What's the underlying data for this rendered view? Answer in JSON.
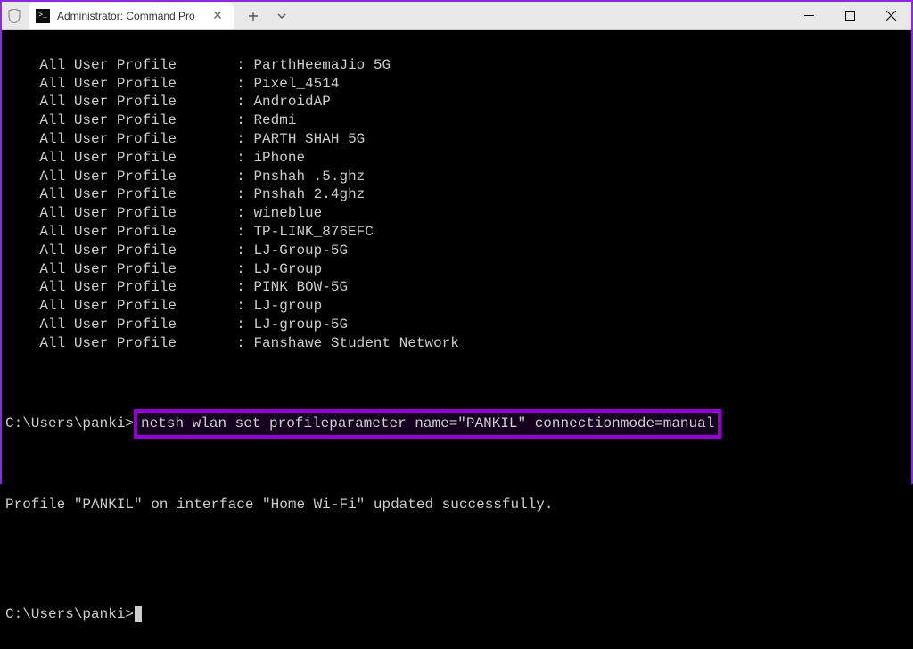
{
  "window": {
    "tab_title": "Administrator: Command Pro"
  },
  "profiles": {
    "label": "All User Profile",
    "items": [
      "ParthHeemaJio 5G",
      "Pixel_4514",
      "AndroidAP",
      "Redmi",
      "PARTH SHAH_5G",
      "iPhone",
      "Pnshah .5.ghz",
      "Pnshah 2.4ghz",
      "wineblue",
      "TP-LINK_876EFC",
      "LJ-Group-5G",
      "LJ-Group",
      "PINK BOW-5G",
      "LJ-group",
      "LJ-group-5G",
      "Fanshawe Student Network"
    ]
  },
  "prompt1": {
    "path": "C:\\Users\\panki>",
    "command": "netsh wlan set profileparameter name=\"PANKIL\" connectionmode=manual"
  },
  "result": "Profile \"PANKIL\" on interface \"Home Wi-Fi\" updated successfully.",
  "prompt2": {
    "path": "C:\\Users\\panki>"
  }
}
